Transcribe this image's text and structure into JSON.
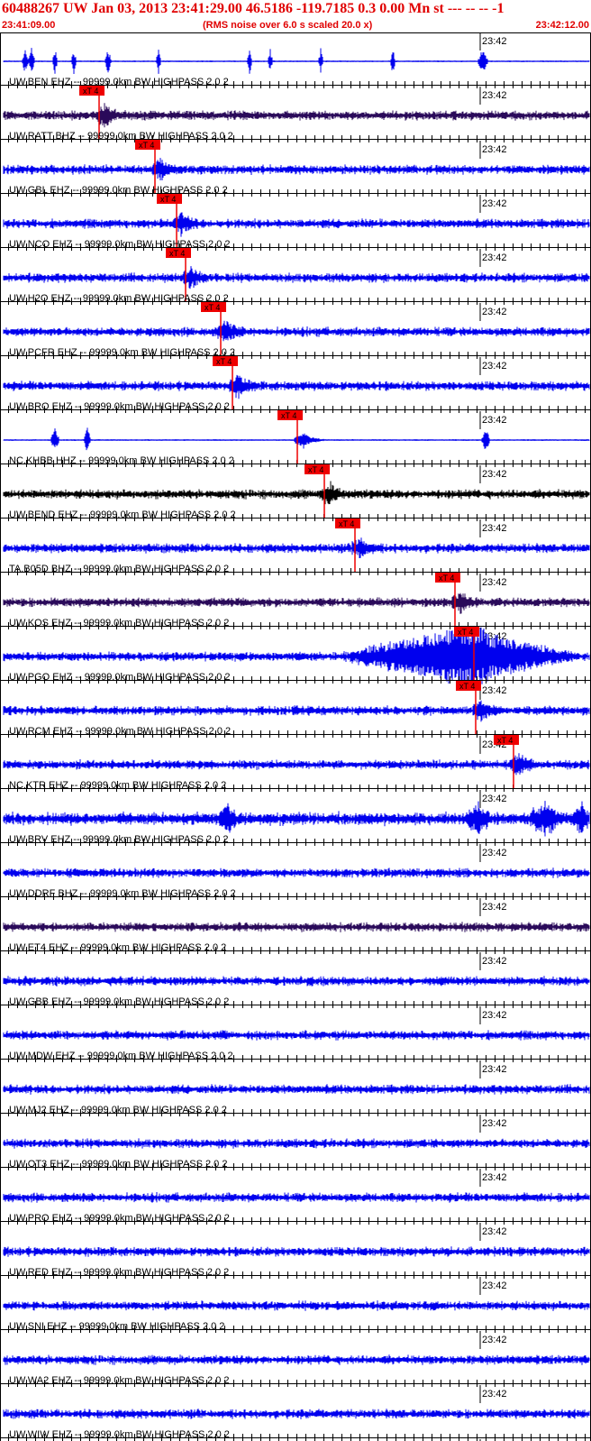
{
  "header": {
    "title": "60488267 UW Jan 03, 2013 23:41:29.00   46.5186 -119.7185  0.3 0.00 Mn st --- -- --  -1",
    "start_time": "23:41:09.00",
    "end_time": "23:42:12.00",
    "subtitle": "(RMS noise over 6.0 s scaled 20.0 x)"
  },
  "minute_label": "23:42",
  "colors": {
    "blue": "#0000ee",
    "dark": "#2a0a5a",
    "black": "#000000",
    "pick": "#ee0000"
  },
  "traces": [
    {
      "label": "",
      "color": "blue",
      "style": "spiky",
      "pick": null
    },
    {
      "label": "UW.BEN EHZ -- 99999.0km BW  HIGHPASS  2.0  2",
      "color": "dark",
      "style": "noise",
      "pick": {
        "text": "xT 4"
      }
    },
    {
      "label": "UW.RATT BHZ -- 99999.0km BW  HIGHPASS  2.0  2",
      "color": "blue",
      "style": "noise",
      "pick": {
        "text": "xT 4"
      }
    },
    {
      "label": "UW.GBL EHZ -- 99999.0km BW  HIGHPASS  2.0  2",
      "color": "blue",
      "style": "noise",
      "pick": {
        "text": "xT 4"
      }
    },
    {
      "label": "UW.NCO EHZ -- 99999.0km BW  HIGHPASS  2.0  2",
      "color": "blue",
      "style": "noise",
      "pick": {
        "text": "xT 4"
      }
    },
    {
      "label": "UW.H2O EHZ -- 99999.0km BW  HIGHPASS  2.0  2",
      "color": "blue",
      "style": "noise",
      "pick": {
        "text": "xT 4"
      }
    },
    {
      "label": "UW.PCFR EHZ -- 99999.0km BW  HIGHPASS  2.0  2",
      "color": "blue",
      "style": "noise",
      "pick": {
        "text": "xT 4"
      }
    },
    {
      "label": "UW.BRO EHZ -- 99999.0km BW  HIGHPASS  2.0  2",
      "color": "blue",
      "style": "spiky",
      "pick": {
        "text": "xT 4"
      }
    },
    {
      "label": "NC.KHBB HHZ -- 99999.0km BW  HIGHPASS  2.0  2",
      "color": "black",
      "style": "noise",
      "pick": {
        "text": "xT 4"
      }
    },
    {
      "label": "UW.BEND EHZ -- 99999.0km BW  HIGHPASS  2.0  2",
      "color": "blue",
      "style": "noise",
      "pick": {
        "text": "xT 4"
      }
    },
    {
      "label": "TA.B05D BHZ -- 99999.0km BW  HIGHPASS  2.0  2",
      "color": "dark",
      "style": "noise",
      "pick": {
        "text": "xT 4"
      }
    },
    {
      "label": "UW.KOS EHZ -- 99999.0km BW  HIGHPASS  2.0  2",
      "color": "blue",
      "style": "saturated",
      "pick": {
        "text": "xT 4"
      }
    },
    {
      "label": "UW.PGO EHZ -- 99999.0km BW  HIGHPASS  2.0  2",
      "color": "blue",
      "style": "noise",
      "pick": {
        "text": "xT 4"
      }
    },
    {
      "label": "UW.RCM EHZ -- 99999.0km BW  HIGHPASS  2.0  2",
      "color": "blue",
      "style": "noise",
      "pick": {
        "text": "xT 4"
      }
    },
    {
      "label": "NC.KTR EHZ -- 99999.0km BW  HIGHPASS  2.0  2",
      "color": "blue",
      "style": "noisy",
      "pick": {
        "text": "xT 4"
      }
    },
    {
      "label": "UW.BRV EHZ -- 99999.0km BW  HIGHPASS  2.0  2",
      "color": "blue",
      "style": "noise",
      "pick": null
    },
    {
      "label": "UW.DDRF BHZ -- 99999.0km BW  HIGHPASS  2.0  2",
      "color": "dark",
      "style": "noise",
      "pick": null
    },
    {
      "label": "UW.ET4 EHZ -- 99999.0km BW  HIGHPASS  2.0  2",
      "color": "blue",
      "style": "noise",
      "pick": null
    },
    {
      "label": "UW.GBB EHZ -- 99999.0km BW  HIGHPASS  2.0  2",
      "color": "blue",
      "style": "noise",
      "pick": null
    },
    {
      "label": "UW.MDW EHZ -- 99999.0km BW  HIGHPASS  2.0  2",
      "color": "blue",
      "style": "noise",
      "pick": null
    },
    {
      "label": "UW.MJ2 EHZ -- 99999.0km BW  HIGHPASS  2.0  2",
      "color": "blue",
      "style": "noise",
      "pick": null
    },
    {
      "label": "UW.OT3 EHZ -- 99999.0km BW  HIGHPASS  2.0  2",
      "color": "blue",
      "style": "noise",
      "pick": null
    },
    {
      "label": "UW.PRO EHZ -- 99999.0km BW  HIGHPASS  2.0  2",
      "color": "blue",
      "style": "noise",
      "pick": null
    },
    {
      "label": "UW.RED EHZ -- 99999.0km BW  HIGHPASS  2.0  2",
      "color": "blue",
      "style": "noise",
      "pick": null
    },
    {
      "label": "UW.SNI EHZ -- 99999.0km BW  HIGHPASS  2.0  2",
      "color": "blue",
      "style": "noise",
      "pick": null
    },
    {
      "label": "UW.WA2 EHZ -- 99999.0km BW  HIGHPASS  2.0  2",
      "color": "blue",
      "style": "noise",
      "pick": null
    },
    {
      "label": "UW.WIW EHZ -- 99999.0km BW  HIGHPASS  2.0  2",
      "color": "blue",
      "style": "noise",
      "pick": null
    }
  ]
}
